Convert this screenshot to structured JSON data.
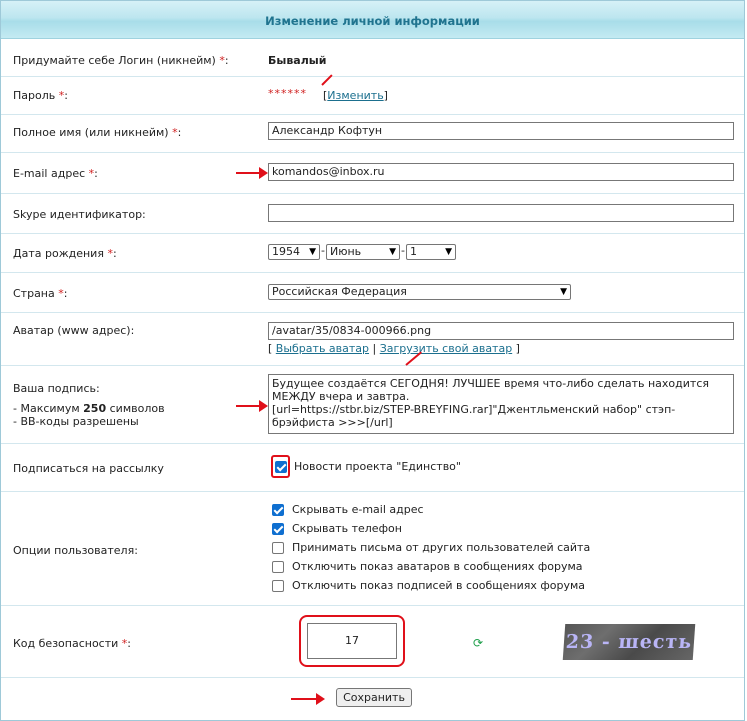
{
  "header": {
    "title": "Изменение личной информации"
  },
  "required_mark": "*",
  "labels": {
    "login": "Придумайте себе Логин (никнейм)",
    "password": "Пароль",
    "fullname": "Полное имя (или никнейм)",
    "email": "E-mail адрес",
    "skype": "Skype идентификатор:",
    "birthdate": "Дата рождения",
    "country": "Страна",
    "avatar": "Аватар (www адрес):",
    "signature": "Ваша подпись:",
    "signature_rule_prefix": "- Максимум",
    "signature_max": "250",
    "signature_rule_suffix": "символов",
    "signature_bbcode": "- BB-коды разрешены",
    "subscribe": "Подписаться на рассылку",
    "options": "Опции пользователя:",
    "captcha": "Код безопасности"
  },
  "values": {
    "login": "Бывалый",
    "password_mask": "******",
    "change_password_link": "Изменить",
    "fullname": "Александр Кофтун",
    "email": "komandos@inbox.ru",
    "skype": "",
    "birth_year": "1954",
    "birth_month": "Июнь",
    "birth_day": "1",
    "country": "Российская Федерация",
    "avatar_url": "/avatar/35/0834-000966.png",
    "choose_avatar_link": "Выбрать аватар",
    "upload_avatar_link": "Загрузить свой аватар",
    "signature_text": "Будущее создаётся СЕГОДНЯ! ЛУЧШЕЕ время что-либо сделать находится МЕЖДУ вчера и завтра.\n[url=https://stbr.biz/STEP-BREYFING.rar]\"Джентльменский набор\" стэп-брэйфиста >>>[/url]",
    "newsletter_label": "Новости проекта \"Единство\"",
    "captcha_input": "17",
    "captcha_image_text": "23 - шесть"
  },
  "options": [
    {
      "label": "Скрывать e-mail адрес",
      "checked": true
    },
    {
      "label": "Скрывать телефон",
      "checked": true
    },
    {
      "label": "Принимать письма от других пользователей сайта",
      "checked": false
    },
    {
      "label": "Отключить показ аватаров в сообщениях форума",
      "checked": false
    },
    {
      "label": "Отключить показ подписей в сообщениях форума",
      "checked": false
    }
  ],
  "newsletter_checked": true,
  "buttons": {
    "save": "Сохранить"
  },
  "colors": {
    "accent": "#1b6f8e",
    "required": "#d02020",
    "annotation": "#e0101a",
    "checkbox": "#0f6fd0"
  }
}
